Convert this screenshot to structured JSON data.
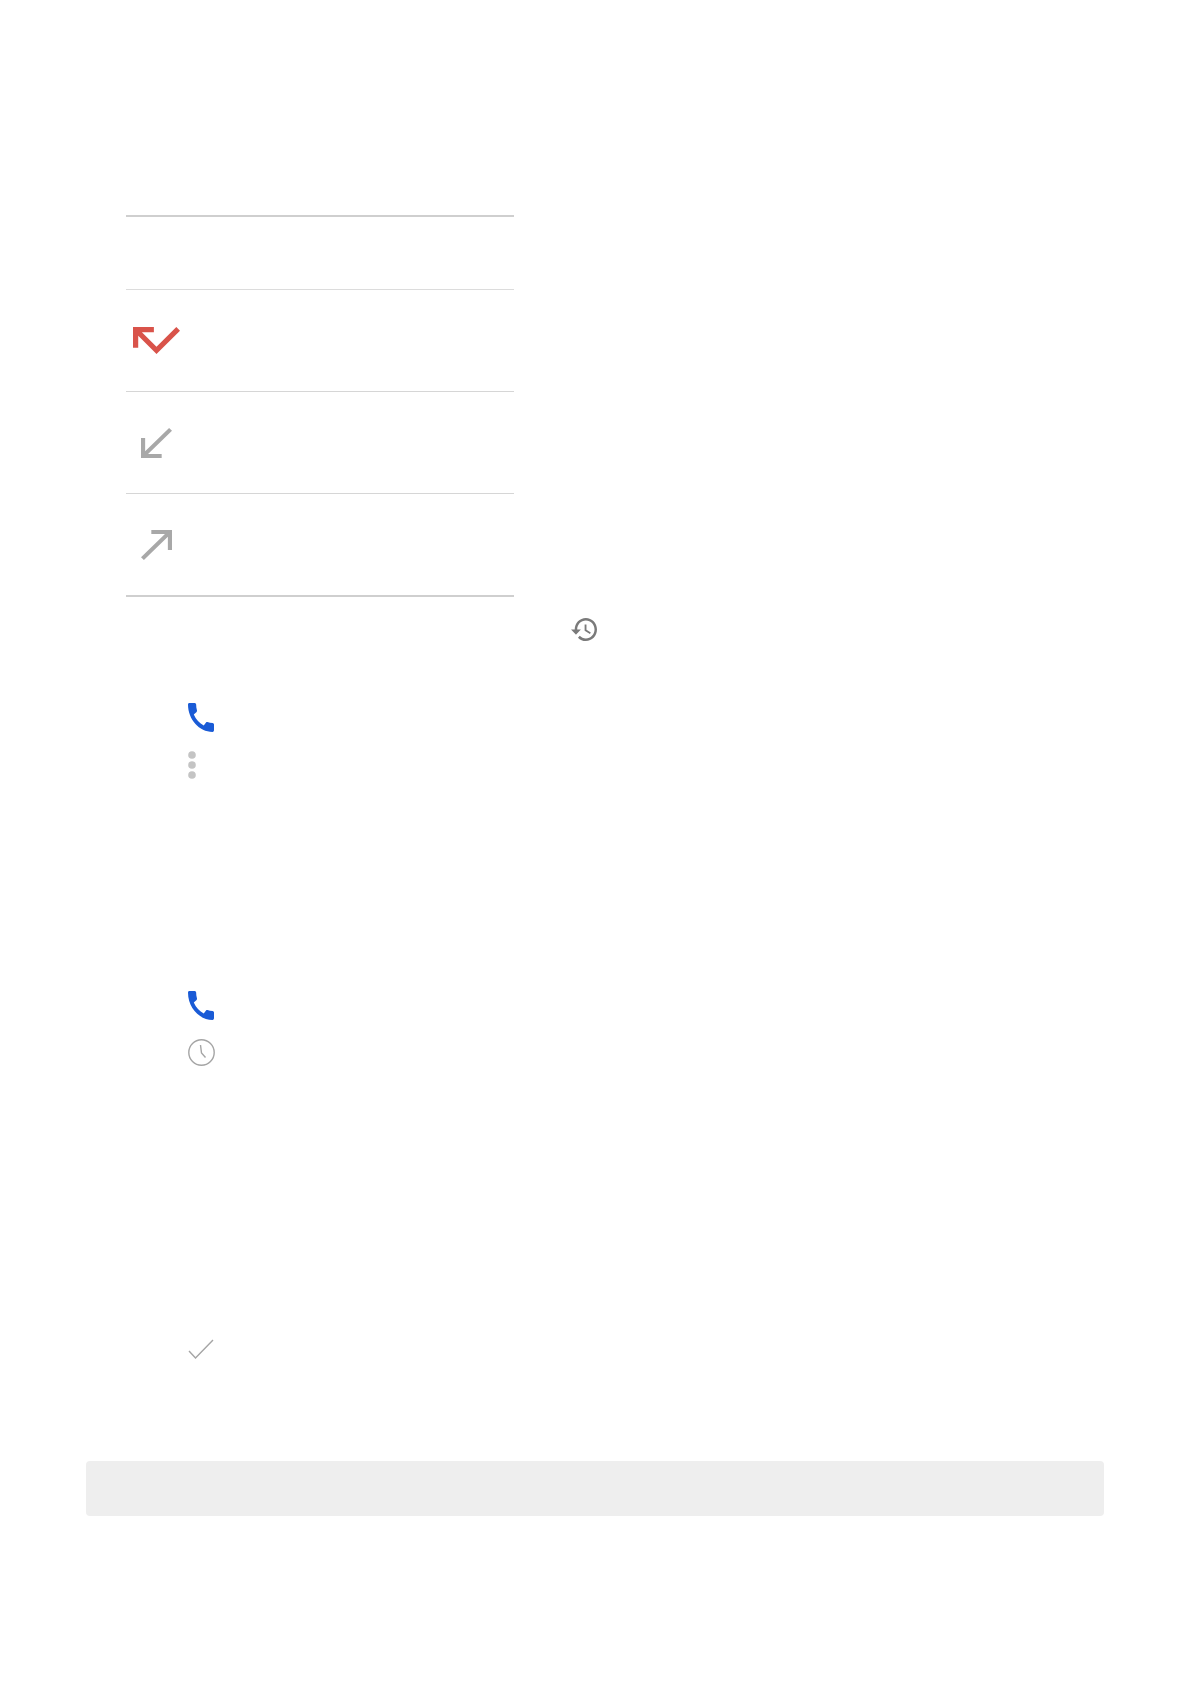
{
  "call_type_table": {
    "rows": [
      {
        "kind": "blank"
      },
      {
        "kind": "missed"
      },
      {
        "kind": "incoming"
      },
      {
        "kind": "outgoing"
      }
    ]
  },
  "toolbar": {
    "icons": [
      {
        "kind": "history"
      }
    ]
  },
  "steps": [
    {
      "icons": [
        {
          "kind": "phone"
        },
        {
          "kind": "more"
        }
      ]
    },
    {
      "icons": [
        {
          "kind": "phone"
        },
        {
          "kind": "clock"
        }
      ]
    },
    {
      "icons": [
        {
          "kind": "check"
        }
      ]
    }
  ]
}
